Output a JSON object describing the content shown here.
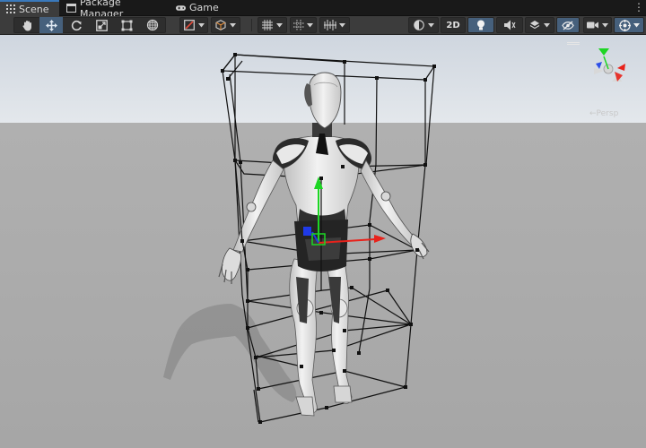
{
  "tabs": [
    {
      "label": "Scene",
      "icon": "scene-icon",
      "active": true
    },
    {
      "label": "Package Manager",
      "icon": "package-icon",
      "active": false
    },
    {
      "label": "Game",
      "icon": "gamepad-icon",
      "active": false
    }
  ],
  "toolbar": {
    "tools": [
      "hand-tool",
      "move-tool",
      "rotate-tool",
      "scale-tool",
      "rect-tool",
      "transform-tool"
    ],
    "active_tool": "move-tool",
    "twod_label": "2D",
    "accent_color": "#46607c"
  },
  "scene": {
    "sky_color": "#dfe6ee",
    "ground_color": "#a8a8a8",
    "axis_colors": {
      "x": "#e8221b",
      "y": "#1dd624",
      "z": "#1f3ae8"
    },
    "persp_label": "←Persp"
  }
}
